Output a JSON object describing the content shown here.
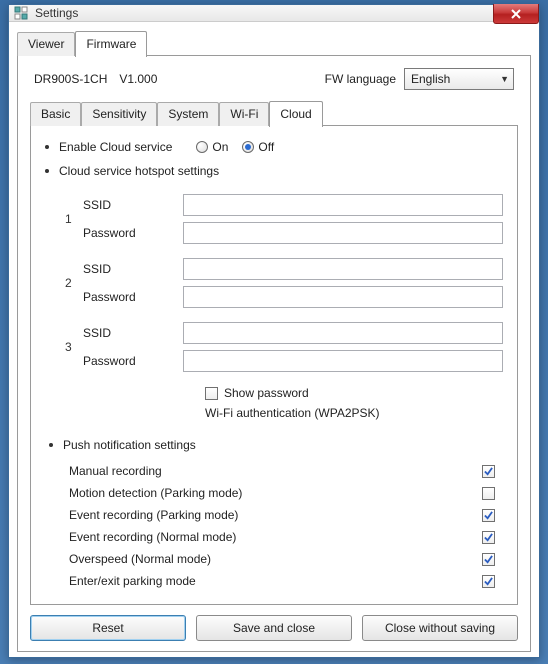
{
  "window": {
    "title": "Settings"
  },
  "outer_tabs": {
    "viewer": "Viewer",
    "firmware": "Firmware",
    "active": "firmware"
  },
  "info": {
    "model": "DR900S-1CH",
    "version": "V1.000",
    "fw_language_label": "FW language",
    "fw_language_value": "English"
  },
  "inner_tabs": {
    "basic": "Basic",
    "sensitivity": "Sensitivity",
    "system": "System",
    "wifi": "Wi-Fi",
    "cloud": "Cloud",
    "active": "cloud"
  },
  "cloud": {
    "enable_label": "Enable Cloud service",
    "on_label": "On",
    "off_label": "Off",
    "selected": "off",
    "hotspot_heading": "Cloud service hotspot settings",
    "ssid_label": "SSID",
    "password_label": "Password",
    "hotspots": [
      {
        "num": "1",
        "ssid": "",
        "password": ""
      },
      {
        "num": "2",
        "ssid": "",
        "password": ""
      },
      {
        "num": "3",
        "ssid": "",
        "password": ""
      }
    ],
    "show_password_label": "Show password",
    "show_password_checked": false,
    "auth_note": "Wi-Fi authentication (WPA2PSK)"
  },
  "push": {
    "heading": "Push notification settings",
    "items": [
      {
        "label": "Manual recording",
        "checked": true
      },
      {
        "label": "Motion detection (Parking mode)",
        "checked": false
      },
      {
        "label": "Event recording (Parking mode)",
        "checked": true
      },
      {
        "label": "Event recording (Normal mode)",
        "checked": true
      },
      {
        "label": "Overspeed (Normal mode)",
        "checked": true
      },
      {
        "label": "Enter/exit parking mode",
        "checked": true
      }
    ]
  },
  "buttons": {
    "reset": "Reset",
    "save": "Save and close",
    "close": "Close without saving"
  }
}
